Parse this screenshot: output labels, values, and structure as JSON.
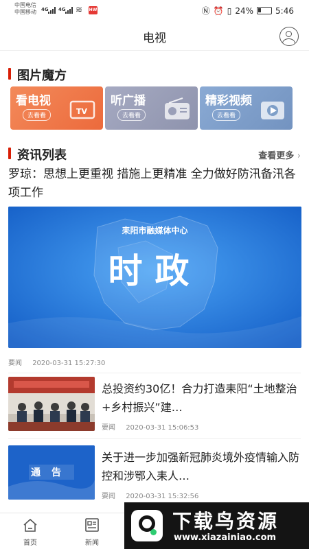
{
  "status_bar": {
    "carrier_1": "中国电信",
    "carrier_2": "中国移动",
    "network_1": "4G",
    "network_2": "4G",
    "app_badge": "HW",
    "battery": "24%",
    "time": "5:46"
  },
  "header": {
    "title": "电视"
  },
  "magic_section": {
    "title": "图片魔方"
  },
  "feature_cards": [
    {
      "title": "看电视",
      "sub": "去看看",
      "color": "#f2784b",
      "icon": "tv-icon"
    },
    {
      "title": "听广播",
      "sub": "去看看",
      "color": "#9a9fb8",
      "icon": "radio-icon"
    },
    {
      "title": "精彩视频",
      "sub": "去看看",
      "color": "#7e9fc8",
      "icon": "video-icon"
    }
  ],
  "news_section": {
    "title": "资讯列表",
    "more": "查看更多"
  },
  "lead_news": {
    "title": "罗琼：思想上更重视 措施上更精准 全力做好防汛备汛各项工作",
    "banner_org": "耒阳市融媒体中心",
    "banner_text": "时政",
    "category": "要闻",
    "time": "2020-03-31 15:27:30"
  },
  "news_list": [
    {
      "title": "总投资约30亿！合力打造耒阳“土地整治+乡村振兴”建…",
      "category": "要闻",
      "time": "2020-03-31 15:06:53"
    },
    {
      "title": "关于进一步加强新冠肺炎境外疫情输入防控和涉鄂入耒人…",
      "category": "要闻",
      "time": "2020-03-31 15:32:56",
      "thumb_text": "通告"
    }
  ],
  "bottom_nav": [
    {
      "label": "首页",
      "icon": "home-icon"
    },
    {
      "label": "新闻",
      "icon": "news-icon"
    }
  ],
  "watermark": {
    "title": "下载鸟资源",
    "url": "www.xiazainiao.com"
  },
  "colors": {
    "accent": "#d81e06",
    "banner_blue": "#1e6fd6"
  }
}
